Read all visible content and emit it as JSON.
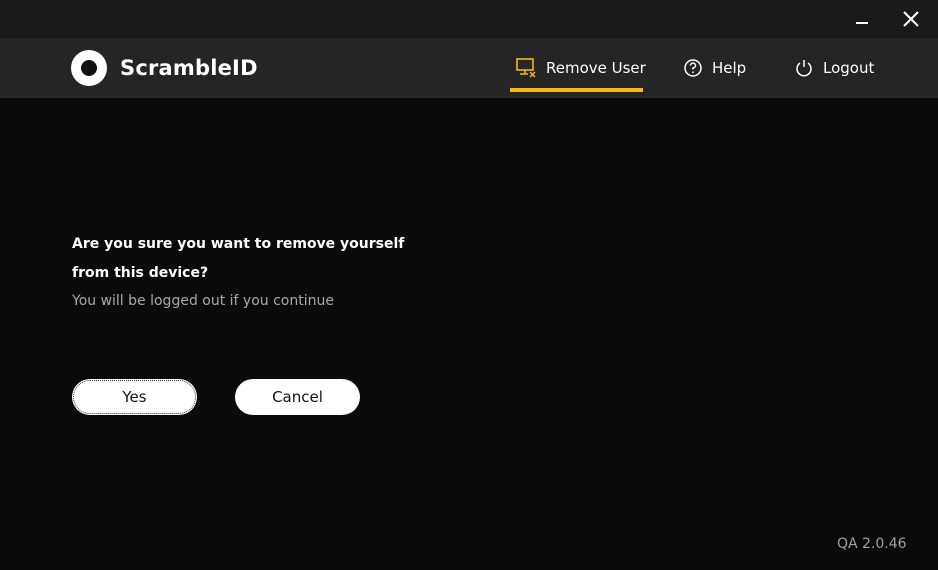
{
  "window": {
    "controls": {
      "minimize": "minimize",
      "close": "close"
    }
  },
  "brand": {
    "name": "ScrambleID"
  },
  "nav": {
    "items": [
      {
        "label": "Remove User",
        "icon": "remove-user-icon",
        "active": true
      },
      {
        "label": "Help",
        "icon": "help-icon",
        "active": false
      },
      {
        "label": "Logout",
        "icon": "power-icon",
        "active": false
      }
    ],
    "accent": "#f5b819"
  },
  "dialog": {
    "question_line1": "Are you sure you want to remove yourself",
    "question_line2": "from this device?",
    "subtext": "You will be logged out if you continue",
    "yes_label": "Yes",
    "cancel_label": "Cancel"
  },
  "version": "QA 2.0.46"
}
